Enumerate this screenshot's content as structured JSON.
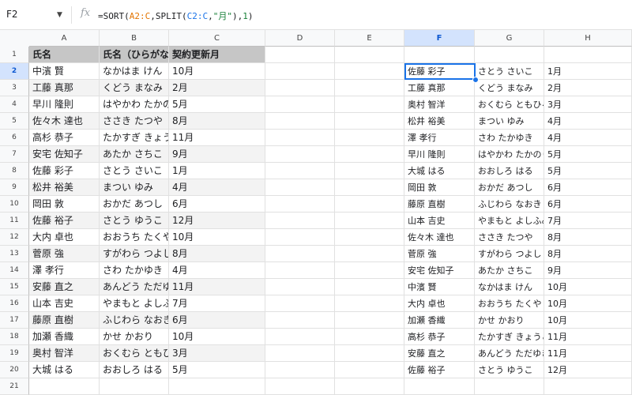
{
  "formula_bar": {
    "name_box": "F2",
    "fx": "fx",
    "formula_parts": {
      "p1": "=SORT(",
      "p2": "A2:C",
      "p3": ",SPLIT(",
      "p4": "C2:C",
      "p5": ",",
      "p6": "\"月\"",
      "p7": "),",
      "p8": "1",
      "p9": ")"
    }
  },
  "columns": [
    "A",
    "B",
    "C",
    "D",
    "E",
    "F",
    "G",
    "H"
  ],
  "rows": [
    "1",
    "2",
    "3",
    "4",
    "5",
    "6",
    "7",
    "8",
    "9",
    "10",
    "11",
    "12",
    "13",
    "14",
    "15",
    "16",
    "17",
    "18",
    "19",
    "20",
    "21"
  ],
  "headers": {
    "a": "氏名",
    "b": "氏名（ひらがな）",
    "c": "契約更新月"
  },
  "source": [
    {
      "a": "中濱 賢",
      "b": "なかはま けん",
      "c": "10月"
    },
    {
      "a": "工藤 真那",
      "b": "くどう まなみ",
      "c": "2月"
    },
    {
      "a": "早川 隆則",
      "b": "はやかわ たかのり",
      "c": "5月"
    },
    {
      "a": "佐々木 達也",
      "b": "ささき たつや",
      "c": "8月"
    },
    {
      "a": "高杉 恭子",
      "b": "たかすぎ きょうこ",
      "c": "11月"
    },
    {
      "a": "安宅 佐知子",
      "b": "あたか さちこ",
      "c": "9月"
    },
    {
      "a": "佐藤 彩子",
      "b": "さとう さいこ",
      "c": "1月"
    },
    {
      "a": "松井 裕美",
      "b": "まつい ゆみ",
      "c": "4月"
    },
    {
      "a": "岡田 敦",
      "b": "おかだ あつし",
      "c": "6月"
    },
    {
      "a": "佐藤 裕子",
      "b": "さとう ゆうこ",
      "c": "12月"
    },
    {
      "a": "大内 卓也",
      "b": "おおうち たくや",
      "c": "10月"
    },
    {
      "a": "菅原 強",
      "b": "すがわら つよし",
      "c": "8月"
    },
    {
      "a": "澤 孝行",
      "b": "さわ たかゆき",
      "c": "4月"
    },
    {
      "a": "安藤 直之",
      "b": "あんどう ただゆき",
      "c": "11月"
    },
    {
      "a": "山本 吉史",
      "b": "やまもと よしふみ",
      "c": "7月"
    },
    {
      "a": "藤原 直樹",
      "b": "ふじわら なおき",
      "c": "6月"
    },
    {
      "a": "加瀬 香織",
      "b": "かせ かおり",
      "c": "10月"
    },
    {
      "a": "奥村 智洋",
      "b": "おくむら ともひろ",
      "c": "3月"
    },
    {
      "a": "大城 はる",
      "b": "おおしろ はる",
      "c": "5月"
    }
  ],
  "sorted": [
    {
      "f": "佐藤 彩子",
      "g": "さとう さいこ",
      "h": "1月"
    },
    {
      "f": "工藤 真那",
      "g": "くどう まなみ",
      "h": "2月"
    },
    {
      "f": "奥村 智洋",
      "g": "おくむら ともひろ",
      "h": "3月"
    },
    {
      "f": "松井 裕美",
      "g": "まつい ゆみ",
      "h": "4月"
    },
    {
      "f": "澤 孝行",
      "g": "さわ たかゆき",
      "h": "4月"
    },
    {
      "f": "早川 隆則",
      "g": "はやかわ たかのり",
      "h": "5月"
    },
    {
      "f": "大城 はる",
      "g": "おおしろ はる",
      "h": "5月"
    },
    {
      "f": "岡田 敦",
      "g": "おかだ あつし",
      "h": "6月"
    },
    {
      "f": "藤原 直樹",
      "g": "ふじわら なおき",
      "h": "6月"
    },
    {
      "f": "山本 吉史",
      "g": "やまもと よしふみ",
      "h": "7月"
    },
    {
      "f": "佐々木 達也",
      "g": "ささき たつや",
      "h": "8月"
    },
    {
      "f": "菅原 強",
      "g": "すがわら つよし",
      "h": "8月"
    },
    {
      "f": "安宅 佐知子",
      "g": "あたか さちこ",
      "h": "9月"
    },
    {
      "f": "中濱 賢",
      "g": "なかはま けん",
      "h": "10月"
    },
    {
      "f": "大内 卓也",
      "g": "おおうち たくや",
      "h": "10月"
    },
    {
      "f": "加瀬 香織",
      "g": "かせ かおり",
      "h": "10月"
    },
    {
      "f": "高杉 恭子",
      "g": "たかすぎ きょうこ",
      "h": "11月"
    },
    {
      "f": "安藤 直之",
      "g": "あんどう ただゆき",
      "h": "11月"
    },
    {
      "f": "佐藤 裕子",
      "g": "さとう ゆうこ",
      "h": "12月"
    }
  ]
}
